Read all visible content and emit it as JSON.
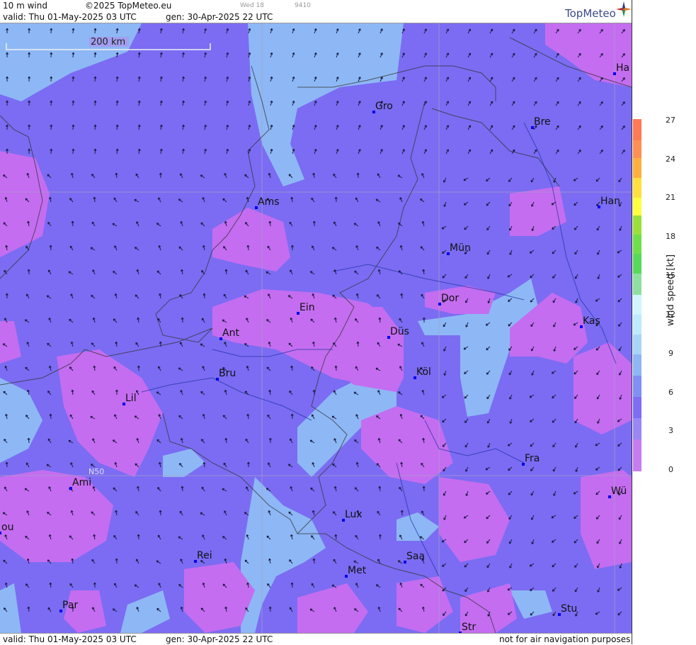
{
  "header": {
    "product": "10 m wind",
    "copyright": "©2025 TopMeteo.eu",
    "faint1": "Wed 18",
    "faint2": "9410",
    "valid": "valid:  Thu  01-May-2025  03 UTC",
    "gen": "gen: 30-Apr-2025 22 UTC"
  },
  "footer": {
    "valid": "valid:  Thu  01-May-2025  03 UTC",
    "gen": "gen: 30-Apr-2025 22 UTC",
    "disclaimer": "not for air navigation purposes"
  },
  "brand": "TopMeteo",
  "scale_bar": "200 km",
  "lat_label": "N50",
  "legend": {
    "title": "wind  speed  [kt]",
    "ticks": [
      "27",
      "24",
      "21",
      "18",
      "15",
      "12",
      "9",
      "6",
      "3",
      "0"
    ],
    "colors": [
      "#c77cf0",
      "#9a86f5",
      "#7f6ef5",
      "#8fb6f5",
      "#bfe9ff",
      "#d0f5ff",
      "#59d95a",
      "#9be03a",
      "#ffff40",
      "#ffb040",
      "#ff7a55"
    ]
  },
  "map_colors": {
    "base": "#7b6cf3",
    "purple": "#c46df0",
    "light": "#8db8f5"
  },
  "cities": [
    {
      "label": "Gro"
    },
    {
      "label": "Bre"
    },
    {
      "label": "Ha"
    },
    {
      "label": "Ams"
    },
    {
      "label": "Han"
    },
    {
      "label": "Mün"
    },
    {
      "label": "Dor"
    },
    {
      "label": "Ein"
    },
    {
      "label": "Ant"
    },
    {
      "label": "Düs"
    },
    {
      "label": "Kas"
    },
    {
      "label": "Bru"
    },
    {
      "label": "Köl"
    },
    {
      "label": "Lil"
    },
    {
      "label": "Fra"
    },
    {
      "label": "Ami"
    },
    {
      "label": "Wü"
    },
    {
      "label": "Lux"
    },
    {
      "label": "ou"
    },
    {
      "label": "Rei"
    },
    {
      "label": "Saa"
    },
    {
      "label": "Met"
    },
    {
      "label": "Par"
    },
    {
      "label": "Stu"
    },
    {
      "label": "Str"
    }
  ]
}
